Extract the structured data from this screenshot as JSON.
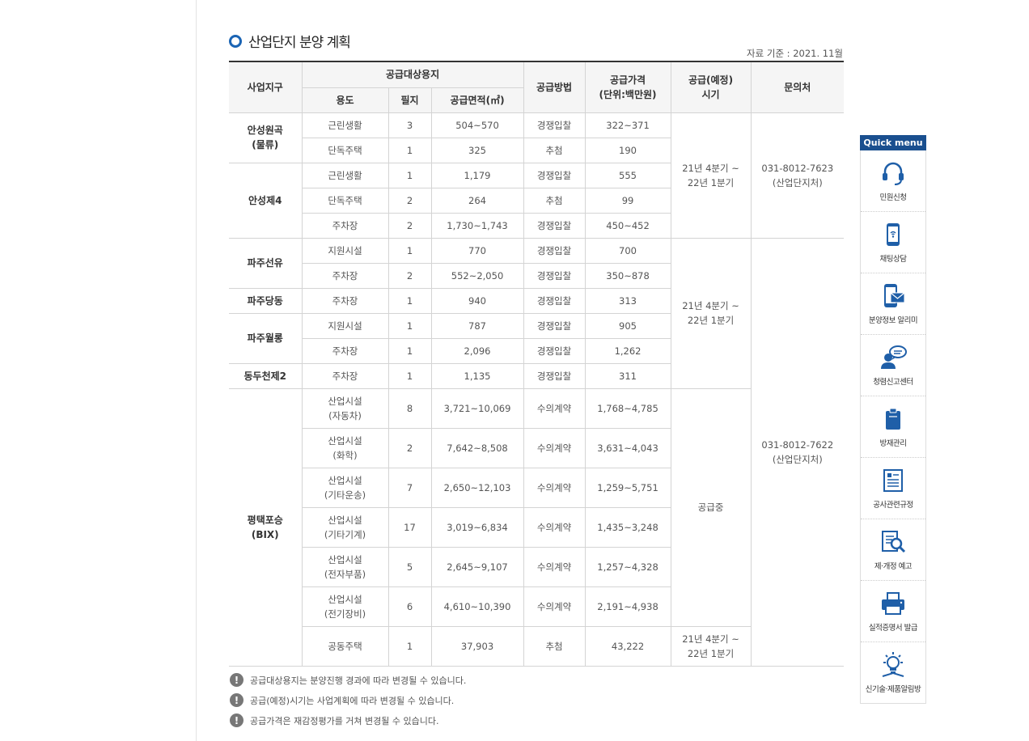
{
  "title": "산업단지 분양 계획",
  "reference_date": "자료 기준 : 2021. 11월",
  "table": {
    "headers": {
      "district": "사업지구",
      "target": "공급대상용지",
      "use": "용도",
      "lots": "필지",
      "area": "공급면적(㎡)",
      "method": "공급방법",
      "price": "공급가격\n(단위:백만원)",
      "period": "공급(예정)\n시기",
      "contact": "문의처"
    },
    "sites": {
      "anseong_wongok": "안성원곡\n(물류)",
      "anseong4": "안성제4",
      "paju_seonyu": "파주선유",
      "paju_dangdong": "파주당동",
      "paju_wolrong": "파주월롱",
      "dongducheon2": "동두천제2",
      "pyeongtaek": "평택포승\n(BIX)"
    },
    "periods": {
      "p1": "21년 4분기 ~\n22년 1분기",
      "p2": "21년 4분기 ~\n22년 1분기",
      "p3": "공급중",
      "p4": "21년 4분기 ~\n22년 1분기"
    },
    "contacts": {
      "c1": "031-8012-7623\n(산업단지처)",
      "c2": "031-8012-7622\n(산업단지처)"
    },
    "rows": [
      {
        "use": "근린생활",
        "lots": "3",
        "area": "504~570",
        "method": "경쟁입찰",
        "price": "322~371"
      },
      {
        "use": "단독주택",
        "lots": "1",
        "area": "325",
        "method": "추첨",
        "price": "190"
      },
      {
        "use": "근린생활",
        "lots": "1",
        "area": "1,179",
        "method": "경쟁입찰",
        "price": "555"
      },
      {
        "use": "단독주택",
        "lots": "2",
        "area": "264",
        "method": "추첨",
        "price": "99"
      },
      {
        "use": "주차장",
        "lots": "2",
        "area": "1,730~1,743",
        "method": "경쟁입찰",
        "price": "450~452"
      },
      {
        "use": "지원시설",
        "lots": "1",
        "area": "770",
        "method": "경쟁입찰",
        "price": "700"
      },
      {
        "use": "주차장",
        "lots": "2",
        "area": "552~2,050",
        "method": "경쟁입찰",
        "price": "350~878"
      },
      {
        "use": "주차장",
        "lots": "1",
        "area": "940",
        "method": "경쟁입찰",
        "price": "313"
      },
      {
        "use": "지원시설",
        "lots": "1",
        "area": "787",
        "method": "경쟁입찰",
        "price": "905"
      },
      {
        "use": "주차장",
        "lots": "1",
        "area": "2,096",
        "method": "경쟁입찰",
        "price": "1,262"
      },
      {
        "use": "주차장",
        "lots": "1",
        "area": "1,135",
        "method": "경쟁입찰",
        "price": "311"
      },
      {
        "use": "산업시설\n(자동차)",
        "lots": "8",
        "area": "3,721~10,069",
        "method": "수의계약",
        "price": "1,768~4,785"
      },
      {
        "use": "산업시설\n(화학)",
        "lots": "2",
        "area": "7,642~8,508",
        "method": "수의계약",
        "price": "3,631~4,043"
      },
      {
        "use": "산업시설\n(기타운송)",
        "lots": "7",
        "area": "2,650~12,103",
        "method": "수의계약",
        "price": "1,259~5,751"
      },
      {
        "use": "산업시설\n(기타기계)",
        "lots": "17",
        "area": "3,019~6,834",
        "method": "수의계약",
        "price": "1,435~3,248"
      },
      {
        "use": "산업시설\n(전자부품)",
        "lots": "5",
        "area": "2,645~9,107",
        "method": "수의계약",
        "price": "1,257~4,328"
      },
      {
        "use": "산업시설\n(전기장비)",
        "lots": "6",
        "area": "4,610~10,390",
        "method": "수의계약",
        "price": "2,191~4,938"
      },
      {
        "use": "공동주택",
        "lots": "1",
        "area": "37,903",
        "method": "추첨",
        "price": "43,222"
      }
    ]
  },
  "notes": [
    "공급대상용지는 분양진행 경과에 따라 변경될 수 있습니다.",
    "공급(예정)시기는 사업계획에 따라 변경될 수 있습니다.",
    "공급가격은 재감정평가를 거쳐 변경될 수 있습니다."
  ],
  "note_icon": "!",
  "quick_menu": {
    "title": "Quick menu",
    "items": [
      {
        "label": "민원신청",
        "icon": "headset-icon"
      },
      {
        "label": "채팅상담",
        "icon": "mobile-chat-icon"
      },
      {
        "label": "분양정보 알리미",
        "icon": "mobile-mail-icon"
      },
      {
        "label": "청렴신고센터",
        "icon": "speech-person-icon"
      },
      {
        "label": "방재관리",
        "icon": "clipboard-icon"
      },
      {
        "label": "공사관련규정",
        "icon": "document-icon"
      },
      {
        "label": "제·개정 예고",
        "icon": "magnifier-doc-icon"
      },
      {
        "label": "실적증명서 발급",
        "icon": "printer-icon"
      },
      {
        "label": "신기술·제품알림방",
        "icon": "lightbulb-icon"
      }
    ]
  },
  "colors": {
    "accent": "#1a64b4",
    "quick_header": "#1a4f8f",
    "icon": "#1f5fa8"
  }
}
